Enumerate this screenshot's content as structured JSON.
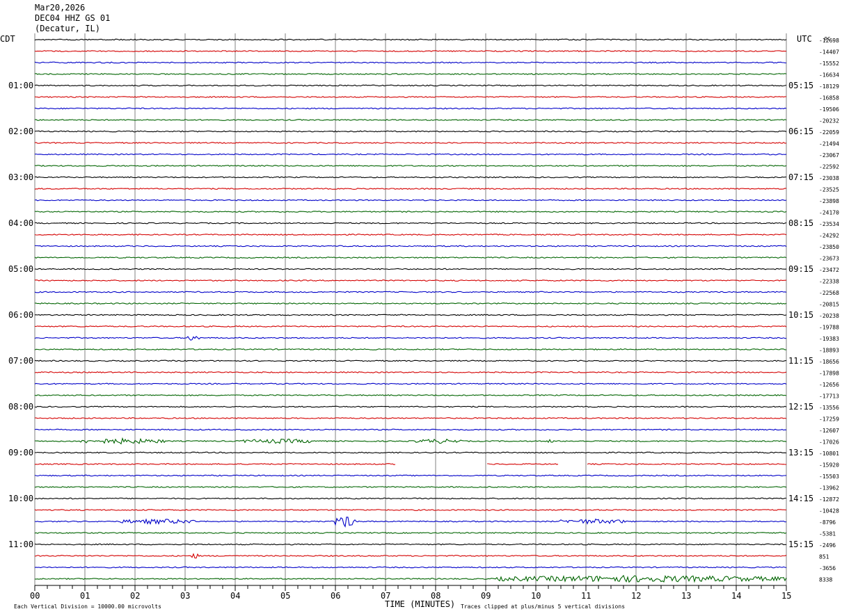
{
  "header": {
    "date": "Mar20,2026",
    "station": "DEC04 HHZ GS 01",
    "location": "(Decatur, IL)"
  },
  "left_zone_label": "CDT",
  "right_zone_label": "UTC",
  "dc_label": "DC",
  "footer": {
    "scale_note": "Each Vertical Division = 10000.00 microvolts",
    "clip_note": "Traces clipped at plus/minus 5 vertical divisions"
  },
  "colors": {
    "trace_cycle": [
      "#000000",
      "#d40000",
      "#0000c8",
      "#006400"
    ],
    "grid": "#808080"
  },
  "chart_data": {
    "type": "line",
    "title": "",
    "xlabel": "TIME (MINUTES)",
    "xlim": [
      0,
      15
    ],
    "x_ticks": [
      "00",
      "01",
      "02",
      "03",
      "04",
      "05",
      "06",
      "07",
      "08",
      "09",
      "10",
      "11",
      "12",
      "13",
      "14",
      "15"
    ],
    "trace_count": 48,
    "traces_per_hour": 4,
    "left_hour_labels": [
      "01:00",
      "02:00",
      "03:00",
      "04:00",
      "05:00",
      "06:00",
      "07:00",
      "08:00",
      "09:00",
      "10:00",
      "11:00"
    ],
    "right_hour_labels": [
      "05:15",
      "06:15",
      "07:15",
      "08:15",
      "09:15",
      "10:15",
      "11:15",
      "12:15",
      "13:15",
      "14:15",
      "15:15"
    ],
    "dc_offsets": [
      "-12698",
      "-14407",
      "-15552",
      "-16634",
      "-18129",
      "-16858",
      "-19506",
      "-20232",
      "-22059",
      "-21494",
      "-23067",
      "-22592",
      "-23038",
      "-23525",
      "-23898",
      "-24170",
      "-23534",
      "-24292",
      "-23850",
      "-23673",
      "-23472",
      "-22338",
      "-22568",
      "-20815",
      "-20238",
      "-19788",
      "-19383",
      "-18893",
      "-18656",
      "-17898",
      "-12656",
      "-17713",
      "-13556",
      "-17259",
      "-12607",
      "-17026",
      "-10801",
      "-15920",
      "-15503",
      "-13962",
      "-12872",
      "-10428",
      "-8796",
      "-5381",
      "-2496",
      "851",
      "-3656",
      "8338"
    ],
    "events": [
      {
        "trace": 26,
        "minute_start": 3.0,
        "minute_end": 3.3,
        "amplitude": 2.2
      },
      {
        "trace": 35,
        "minute_start": 0.9,
        "minute_end": 2.6,
        "amplitude": 2.0
      },
      {
        "trace": 35,
        "minute_start": 4.1,
        "minute_end": 5.7,
        "amplitude": 1.5
      },
      {
        "trace": 35,
        "minute_start": 7.6,
        "minute_end": 8.5,
        "amplitude": 1.6
      },
      {
        "trace": 35,
        "minute_start": 10.2,
        "minute_end": 10.4,
        "amplitude": 1.3
      },
      {
        "trace": 42,
        "minute_start": 1.7,
        "minute_end": 3.2,
        "amplitude": 1.8
      },
      {
        "trace": 42,
        "minute_start": 6.0,
        "minute_end": 6.4,
        "amplitude": 5.0
      },
      {
        "trace": 42,
        "minute_start": 10.5,
        "minute_end": 11.8,
        "amplitude": 1.8
      },
      {
        "trace": 45,
        "minute_start": 3.1,
        "minute_end": 3.3,
        "amplitude": 2.0
      },
      {
        "trace": 47,
        "minute_start": 9.2,
        "minute_end": 15.0,
        "amplitude": 2.6
      }
    ],
    "gaps": [
      {
        "trace": 37,
        "minute_start": 7.2,
        "minute_end": 9.0
      },
      {
        "trace": 37,
        "minute_start": 10.45,
        "minute_end": 11.0
      }
    ]
  }
}
